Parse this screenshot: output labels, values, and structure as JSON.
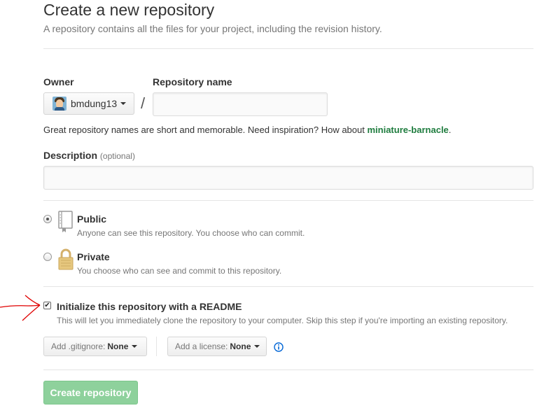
{
  "header": {
    "title": "Create a new repository",
    "subtitle": "A repository contains all the files for your project, including the revision history."
  },
  "owner": {
    "label": "Owner",
    "selected": "bmdung13",
    "avatar": "user-avatar"
  },
  "separator": "/",
  "repo_name": {
    "label": "Repository name",
    "value": "",
    "placeholder": ""
  },
  "name_hint": {
    "text": "Great repository names are short and memorable. Need inspiration? How about ",
    "suggestion": "miniature-barnacle",
    "end": "."
  },
  "description": {
    "label": "Description",
    "optional": "(optional)",
    "value": "",
    "placeholder": ""
  },
  "visibility": {
    "selected": "public",
    "public": {
      "title": "Public",
      "desc": "Anyone can see this repository. You choose who can commit.",
      "icon": "repo-book-icon"
    },
    "private": {
      "title": "Private",
      "desc": "You choose who can see and commit to this repository.",
      "icon": "lock-icon"
    }
  },
  "readme": {
    "checked": true,
    "check_glyph": "✔",
    "title": "Initialize this repository with a README",
    "desc": "This will let you immediately clone the repository to your computer. Skip this step if you're importing an existing repository."
  },
  "gitignore": {
    "prefix": "Add .gitignore:",
    "value": "None"
  },
  "license": {
    "prefix": "Add a license:",
    "value": "None"
  },
  "info_icon": "info-icon",
  "submit_label": "Create repository",
  "colors": {
    "suggestion": "#1e7c3e",
    "submit_bg": "#8ed19c",
    "info": "#0366d6",
    "annotation": "#e00000"
  }
}
